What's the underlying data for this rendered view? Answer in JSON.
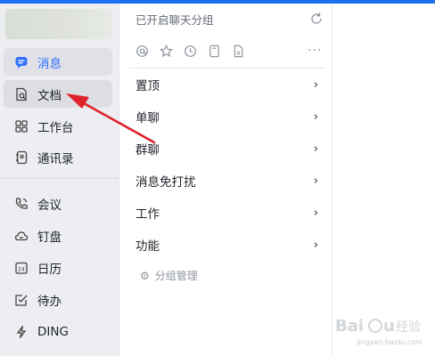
{
  "sidebar": {
    "items": [
      {
        "label": "消息",
        "icon": "chat-icon"
      },
      {
        "label": "文档",
        "icon": "document-icon"
      },
      {
        "label": "工作台",
        "icon": "grid-icon"
      },
      {
        "label": "通讯录",
        "icon": "contacts-icon"
      },
      {
        "label": "会议",
        "icon": "phone-icon"
      },
      {
        "label": "钉盘",
        "icon": "cloud-icon"
      },
      {
        "label": "日历",
        "icon": "calendar-icon"
      },
      {
        "label": "待办",
        "icon": "checkbox-icon"
      },
      {
        "label": "DING",
        "icon": "lightning-icon"
      }
    ]
  },
  "panel": {
    "title": "已开启聊天分组",
    "more": "···",
    "groups": [
      "置顶",
      "单聊",
      "群聊",
      "消息免打扰",
      "工作",
      "功能"
    ],
    "manage_label": "分组管理"
  },
  "watermark": {
    "brand": "Baidu经验",
    "url": "jingyan.baidu.com"
  },
  "colors": {
    "accent": "#3370ff",
    "annotation_arrow": "#e0232a",
    "sidebar_bg": "#eceef1"
  }
}
